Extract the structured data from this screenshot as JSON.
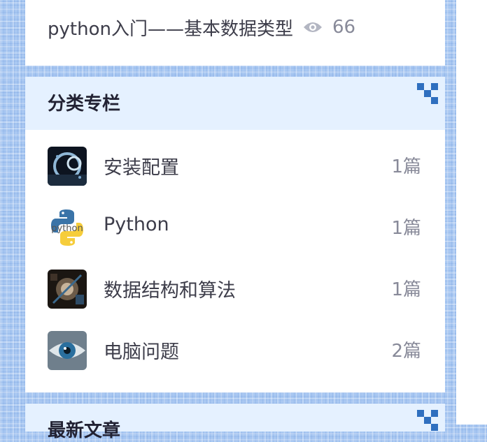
{
  "top_article": {
    "title": "python入门——基本数据类型",
    "views": "66"
  },
  "categories_section": {
    "title": "分类专栏",
    "items": [
      {
        "label": "安装配置",
        "count": "1篇",
        "icon": "settings-thumb"
      },
      {
        "label": "Python",
        "count": "1篇",
        "icon": "python-logo"
      },
      {
        "label": "数据结构和算法",
        "count": "1篇",
        "icon": "algorithm-thumb"
      },
      {
        "label": "电脑问题",
        "count": "2篇",
        "icon": "eye-thumb"
      }
    ]
  },
  "next_section": {
    "title": "最新文章"
  },
  "colors": {
    "header_bg": "#e5f1ff",
    "accent": "#2f6fbf",
    "muted_text": "#888a99"
  }
}
